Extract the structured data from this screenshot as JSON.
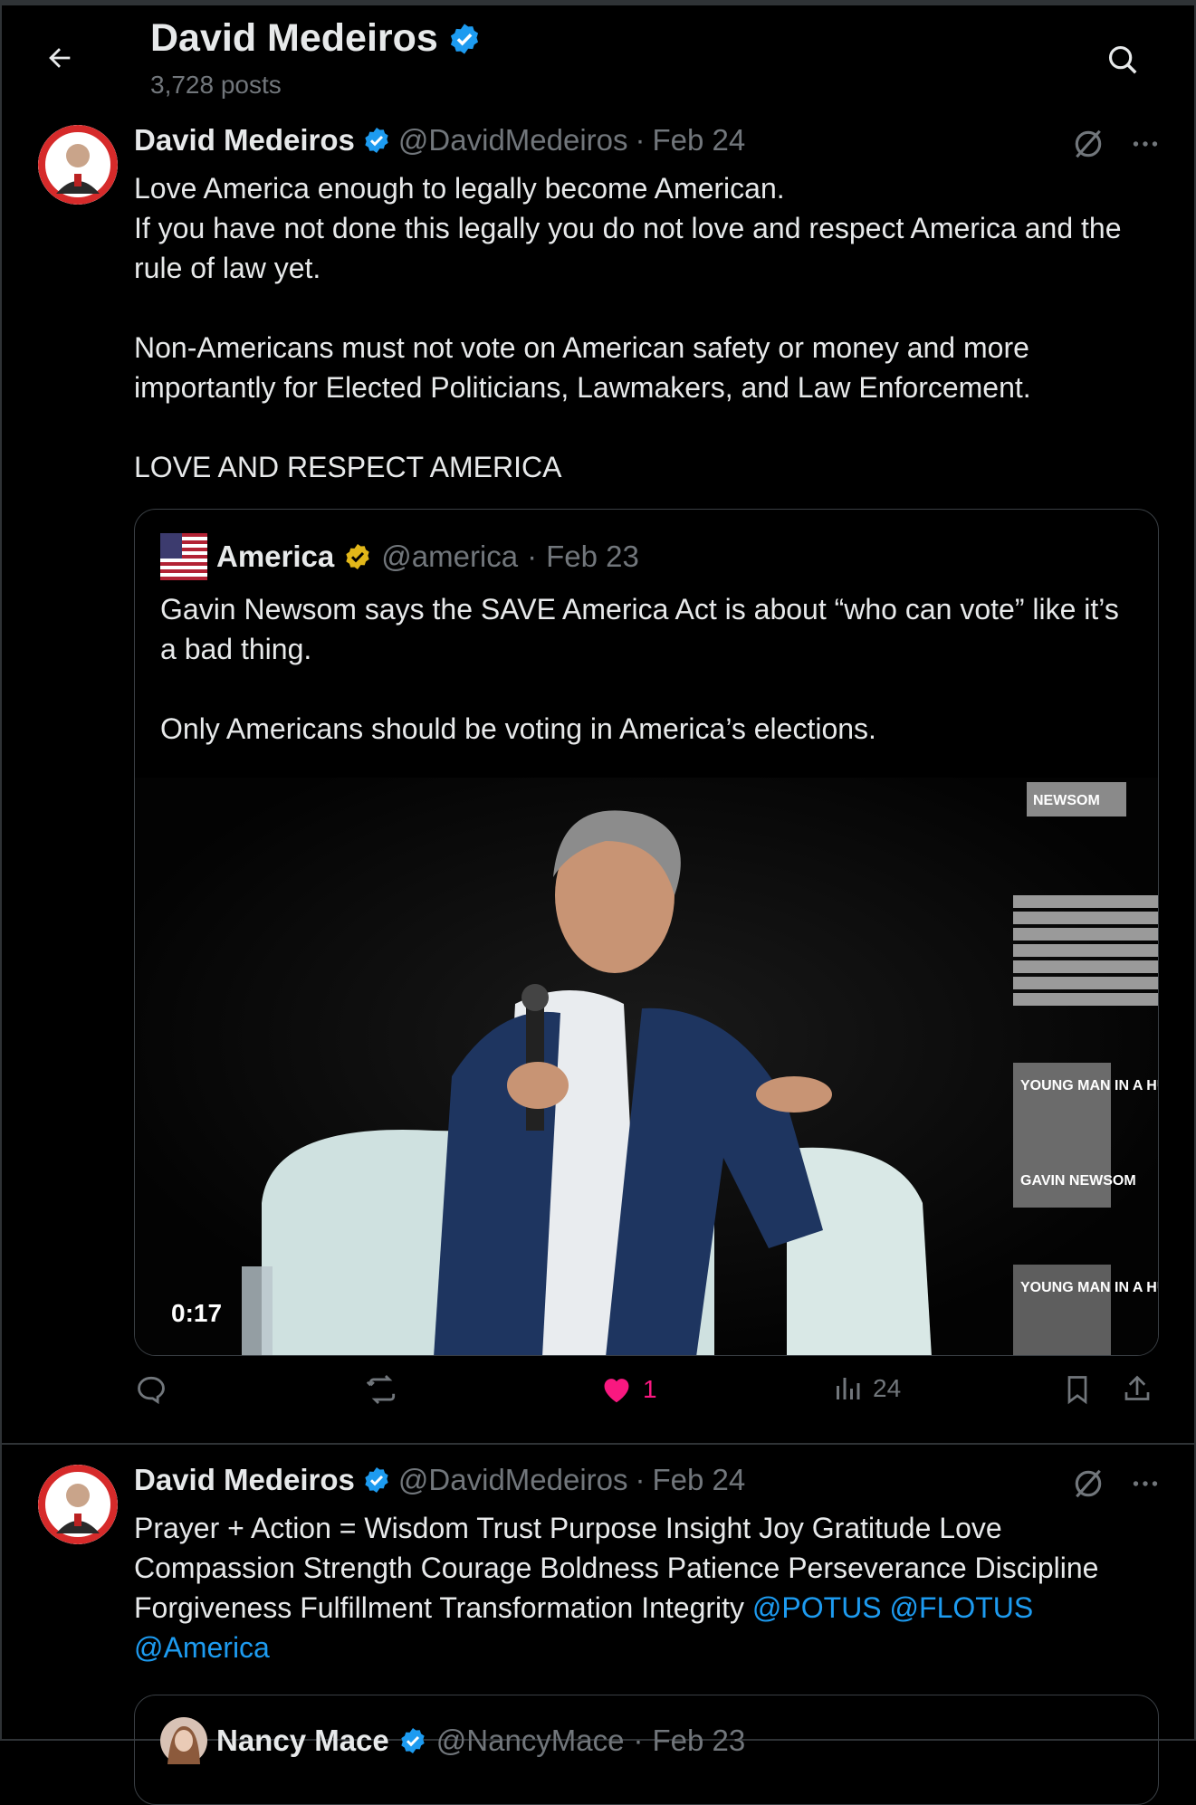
{
  "header": {
    "title": "David Medeiros",
    "post_count": "3,728 posts"
  },
  "posts": [
    {
      "name": "David Medeiros",
      "handle": "@DavidMedeiros",
      "sep": "·",
      "date": "Feb 24",
      "paragraphs": [
        "Love America enough to legally become American.",
        "If you have not done this legally you do not love and respect America and the rule of law yet.",
        "Non-Americans must not vote on American safety or money and more importantly for Elected Politicians, Lawmakers, and Law Enforcement.",
        "LOVE AND RESPECT AMERICA"
      ],
      "quote": {
        "name": "America",
        "handle": "@america",
        "sep": "·",
        "date": "Feb 23",
        "paragraphs": [
          "Gavin Newsom says the SAVE America Act is about “who can vote” like it’s a bad thing.",
          "Only Americans should be voting in America’s elections."
        ],
        "video_duration": "0:17",
        "video_book_labels": [
          "NEWSOM",
          "YOUNG MAN IN A HURRY",
          "GAVIN NEWSOM",
          "YOUNG MAN IN A HURRY"
        ]
      },
      "actions": {
        "replies": "",
        "reposts": "",
        "likes": "1",
        "views": "24"
      }
    },
    {
      "name": "David Medeiros",
      "handle": "@DavidMedeiros",
      "sep": "·",
      "date": "Feb 24",
      "text": "Prayer + Action = Wisdom Trust Purpose Insight Joy Gratitude Love Compassion Strength Courage Boldness Patience Perseverance Discipline Forgiveness Fulfillment Transformation Integrity",
      "mentions": [
        "@POTUS",
        "@FLOTUS",
        "@America"
      ],
      "quote": {
        "name": "Nancy Mace",
        "handle": "@NancyMace",
        "sep": "·",
        "date": "Feb 23"
      }
    }
  ],
  "colors": {
    "background": "#000000",
    "text": "#e7e9ea",
    "muted": "#71767b",
    "accent": "#1d9bf0",
    "like": "#f91880",
    "gold_badge": "#e2b719",
    "divider": "#2f3336"
  },
  "icons": [
    "back-arrow-icon",
    "search-icon",
    "verified-badge-icon",
    "grok-icon",
    "more-icon",
    "reply-icon",
    "repost-icon",
    "heart-icon",
    "views-icon",
    "bookmark-icon",
    "share-icon"
  ]
}
